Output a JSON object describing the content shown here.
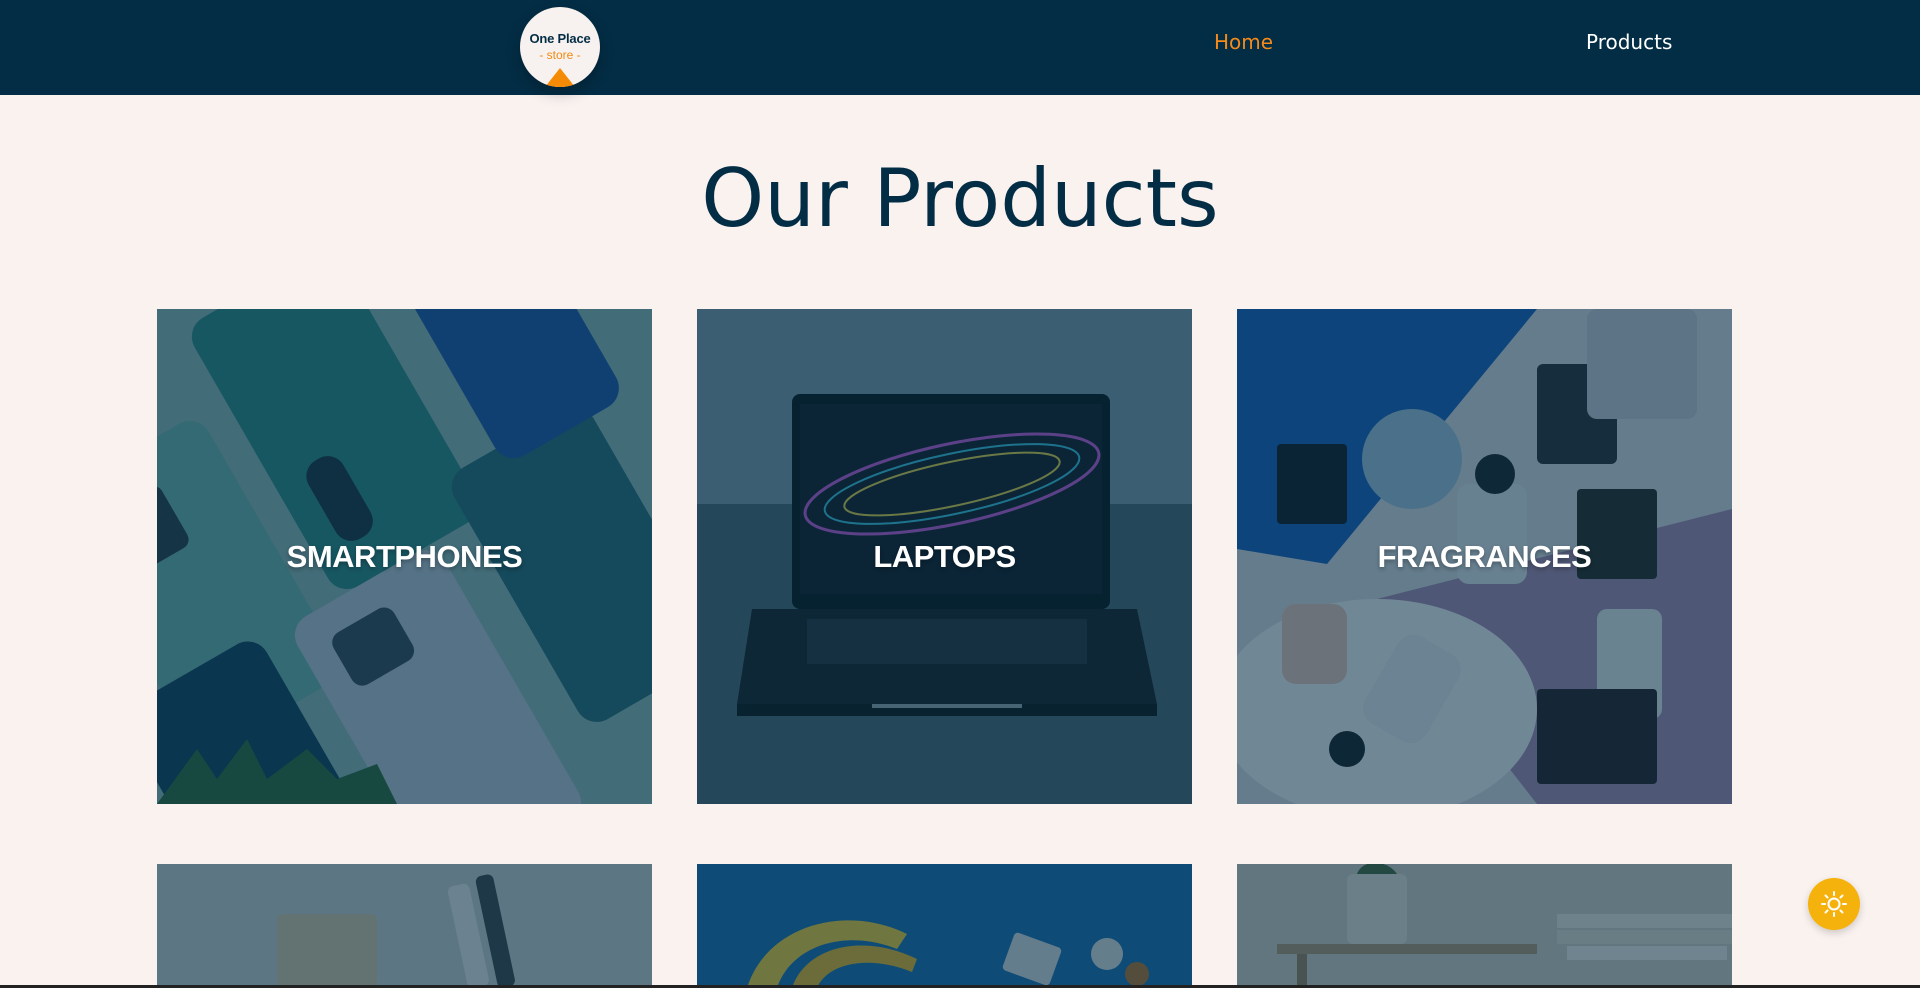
{
  "brand": {
    "name": "One Place",
    "tagline": "- store -"
  },
  "nav": {
    "home": "Home",
    "products": "Products",
    "active": "Home"
  },
  "page": {
    "title": "Our Products"
  },
  "categories": [
    {
      "label": "SMARTPHONES",
      "icon": "smartphones-image"
    },
    {
      "label": "LAPTOPS",
      "icon": "laptop-image"
    },
    {
      "label": "FRAGRANCES",
      "icon": "fragrances-image"
    },
    {
      "label": "",
      "icon": "skincare-image"
    },
    {
      "label": "",
      "icon": "groceries-image"
    },
    {
      "label": "",
      "icon": "home-decoration-image"
    }
  ],
  "theme_toggle": {
    "icon": "sun-icon"
  },
  "colors": {
    "navbar": "#032d45",
    "accent": "#f48a1c",
    "page_bg": "#faf2ef",
    "toggle": "#f6b20c"
  }
}
